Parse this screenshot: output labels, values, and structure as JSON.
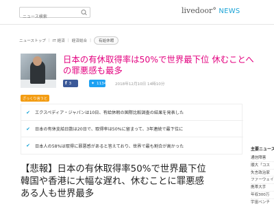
{
  "header": {
    "search_placeholder": "ニュース検索",
    "logo_main": "livedoor",
    "logo_sub": "NEWS"
  },
  "breadcrumb": {
    "items": [
      "ニューストップ",
      "IT 経済",
      "経済総合",
      "有給休暇"
    ]
  },
  "article": {
    "title": "日本の有休取得率は50%で世界最下位 休むことへの罪悪感も最多",
    "fb_count": "3",
    "tw_count": "1134",
    "date": "2018年12月10日 14時10分"
  },
  "summary": {
    "tag": "ざっくり言うと",
    "points": [
      "エクスペディア・ジャパンは10日、有給休暇の国際比較調査の結果を発表した",
      "日本の有休支給日数は20日で、取得率は50%に留まって、3年連続で最下位に",
      "日本人の58%は取得に罪悪感があると答えており、世界で最も割合が高かった"
    ]
  },
  "headline": {
    "line1": "【悲報】日本の有休取得率50%で世界最下位",
    "line2": "韓国や香港に大幅な遅れ、休むことに罪悪感",
    "line3": "ある人も世界最多"
  },
  "sidebar": {
    "title": "主要ニュース",
    "items": [
      "通信障害",
      "順大「コス",
      "失言政治家",
      "ファーウェイ",
      "携帯大手",
      "年収300万",
      "宇宙ベンチ"
    ]
  },
  "colors": {
    "title_pink": "#e3007f",
    "accent_blue": "#19a3d6",
    "facebook": "#3b5998",
    "twitter": "#1da1f2",
    "tag_orange": "#f39c12"
  }
}
